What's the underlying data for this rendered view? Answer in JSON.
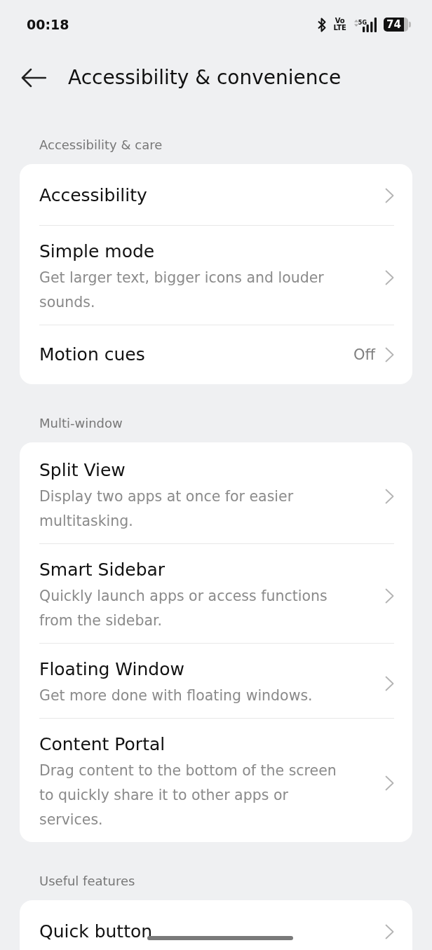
{
  "status_bar": {
    "time": "00:18",
    "volte": "Vo LTE",
    "network": "5G",
    "battery": "74"
  },
  "header": {
    "title": "Accessibility & convenience"
  },
  "sections": [
    {
      "label": "Accessibility & care",
      "items": [
        {
          "title": "Accessibility"
        },
        {
          "title": "Simple mode",
          "subtitle": "Get larger text, bigger icons and louder sounds."
        },
        {
          "title": "Motion cues",
          "value": "Off"
        }
      ]
    },
    {
      "label": "Multi-window",
      "items": [
        {
          "title": "Split View",
          "subtitle": "Display two apps at once for easier multitasking."
        },
        {
          "title": "Smart Sidebar",
          "subtitle": "Quickly launch apps or access functions from the sidebar."
        },
        {
          "title": "Floating Window",
          "subtitle": "Get more done with floating windows."
        },
        {
          "title": "Content Portal",
          "subtitle": "Drag content to the bottom of the screen to quickly share it to other apps or services."
        }
      ]
    },
    {
      "label": "Useful features",
      "items": [
        {
          "title": "Quick button"
        }
      ]
    }
  ]
}
